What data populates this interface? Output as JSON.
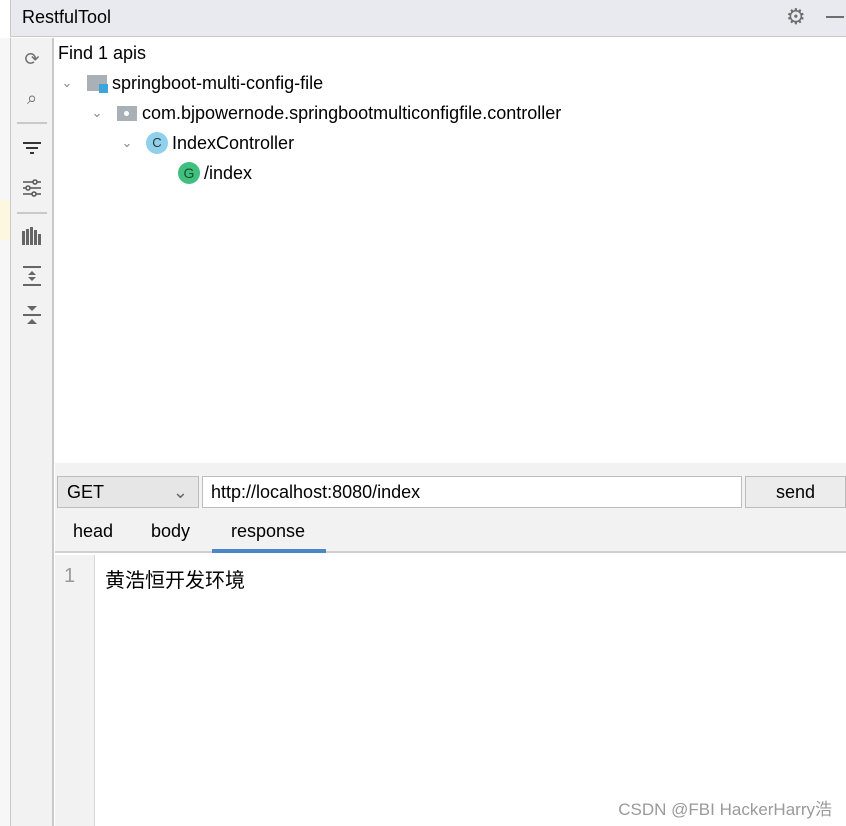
{
  "window": {
    "title": "RestfulTool",
    "settings_icon": "gear-icon",
    "minimize_icon": "minimize-icon"
  },
  "toolbar": {
    "items": [
      "refresh-icon",
      "search-icon",
      "filter-icon",
      "settings-sliders-icon",
      "bar-chart-icon",
      "expand-all-icon",
      "collapse-all-icon"
    ]
  },
  "tree": {
    "summary": "Find 1 apis",
    "project": "springboot-multi-config-file",
    "package": "com.bjpowernode.springbootmulticonfigfile.controller",
    "class": "IndexController",
    "class_badge": "C",
    "endpoint": "/index",
    "endpoint_badge": "G"
  },
  "request": {
    "method": "GET",
    "url": "http://localhost:8080/index",
    "send_label": "send"
  },
  "tabs": [
    {
      "label": "head"
    },
    {
      "label": "body"
    },
    {
      "label": "response",
      "active": true
    }
  ],
  "response": {
    "line_number": "1",
    "content": "黄浩恒开发环境"
  },
  "watermark": "CSDN @FBI HackerHarry浩",
  "colors": {
    "accent": "#4a86c8",
    "endpoint_green": "#3fc07e",
    "class_blue": "#8fd0ec"
  }
}
